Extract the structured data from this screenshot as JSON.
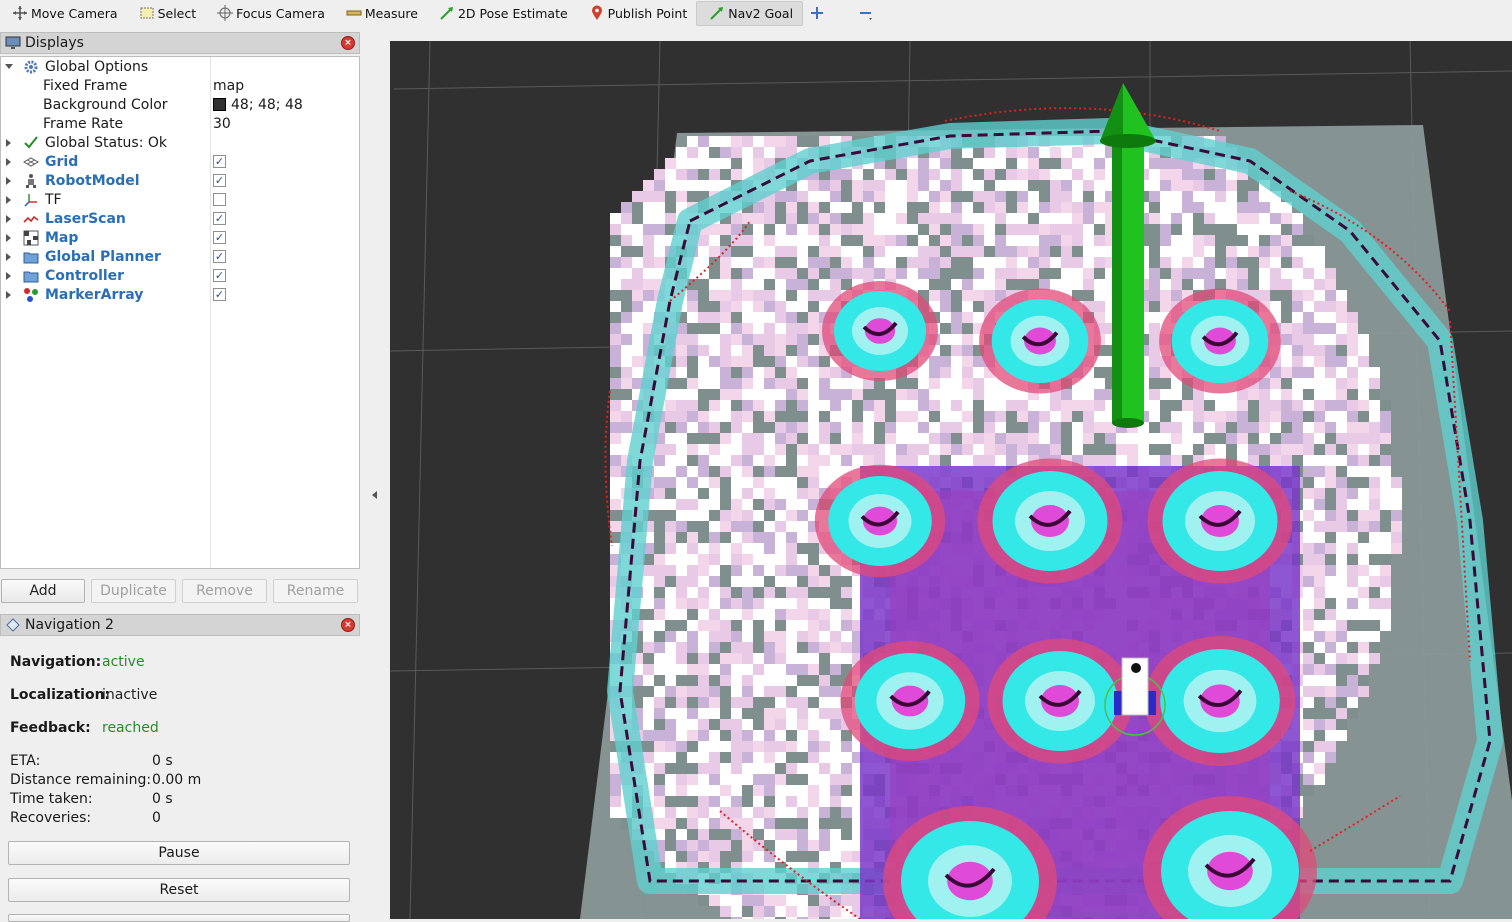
{
  "toolbar": {
    "tools": [
      {
        "label": "Move Camera",
        "icon": "move-camera-icon"
      },
      {
        "label": "Select",
        "icon": "select-icon"
      },
      {
        "label": "Focus Camera",
        "icon": "focus-camera-icon"
      },
      {
        "label": "Measure",
        "icon": "measure-icon"
      },
      {
        "label": "2D Pose Estimate",
        "icon": "pose-estimate-icon"
      },
      {
        "label": "Publish Point",
        "icon": "publish-point-icon"
      },
      {
        "label": "Nav2 Goal",
        "icon": "nav2-goal-icon",
        "active": true
      }
    ],
    "add_icon": "plus-icon",
    "remove_icon": "minus-icon"
  },
  "displays": {
    "title": "Displays",
    "global_options": {
      "label": "Global Options",
      "fixed_frame_label": "Fixed Frame",
      "fixed_frame_value": "map",
      "background_color_label": "Background Color",
      "background_color_value": "48; 48; 48",
      "frame_rate_label": "Frame Rate",
      "frame_rate_value": "30"
    },
    "global_status": "Global Status: Ok",
    "items": [
      {
        "label": "Grid",
        "checked": true
      },
      {
        "label": "RobotModel",
        "checked": true
      },
      {
        "label": "TF",
        "checked": false
      },
      {
        "label": "LaserScan",
        "checked": true
      },
      {
        "label": "Map",
        "checked": true
      },
      {
        "label": "Global Planner",
        "checked": true
      },
      {
        "label": "Controller",
        "checked": true
      },
      {
        "label": "MarkerArray",
        "checked": true
      }
    ],
    "buttons": {
      "add": "Add",
      "duplicate": "Duplicate",
      "remove": "Remove",
      "rename": "Rename"
    }
  },
  "navigation": {
    "title": "Navigation 2",
    "navigation_label": "Navigation:",
    "navigation_value": "active",
    "localization_label": "Localization:",
    "localization_value": "inactive",
    "feedback_label": "Feedback:",
    "feedback_value": "reached",
    "eta_label": "ETA:",
    "eta_value": "0 s",
    "distance_label": "Distance remaining:",
    "distance_value": "0.00 m",
    "time_label": "Time taken:",
    "time_value": "0 s",
    "recoveries_label": "Recoveries:",
    "recoveries_value": "0",
    "pause_label": "Pause",
    "reset_label": "Reset"
  },
  "colors": {
    "viewport_background": "#303030",
    "status_green": "#1f8f2a",
    "display_blue": "#2a6fb6",
    "goal_arrow": "#1fc21f"
  }
}
